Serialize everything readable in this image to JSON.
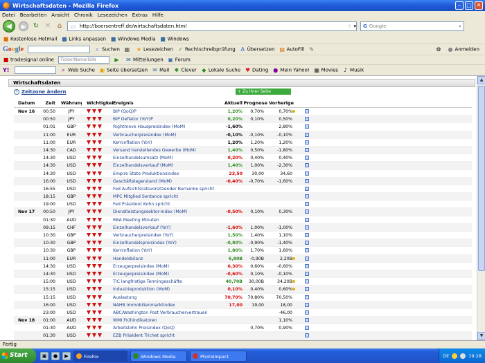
{
  "window": {
    "title": "Wirtschaftsdaten - Mozilla Firefox"
  },
  "menu": [
    "Datei",
    "Bearbeiten",
    "Ansicht",
    "Chronik",
    "Lesezeichen",
    "Extras",
    "Hilfe"
  ],
  "nav": {
    "url": "http://boersentreff.de/wirtschaftsdaten.html",
    "search_placeholder": "Google"
  },
  "bookmarks": [
    "Kostenlose Hotmail",
    "Links anpassen",
    "Windows Media",
    "Windows"
  ],
  "googlebar": {
    "logo": "Google",
    "search": "Suchen",
    "bookmarks_btn": "Lesezeichen",
    "spellcheck": "Rechtschreibprüfung",
    "translate": "Übersetzen",
    "autofill": "AutoFill",
    "signin": "Anmelden"
  },
  "tb3": {
    "tradesignal": "tradesignal online",
    "ticker_placeholder": "Ticker/Name/ISIN",
    "messages": "Mitteilungen",
    "forum": "Forum"
  },
  "tb4": {
    "web_search": "Web Suche",
    "translate": "Seite übersetzen",
    "mail": "Mail",
    "clever": "Clever",
    "local": "Lokale Suche",
    "dating": "Dating",
    "myyahoo": "Mein Yahoo!",
    "movies": "Movies",
    "music": "Musik"
  },
  "page": {
    "heading": "Wirtschaftsdaten",
    "zone_link": "Zeitzone ändern",
    "add_button": "Zu Ihrer Seite hinzufügen"
  },
  "table": {
    "headers": {
      "date": "Datum",
      "time": "Zeit",
      "currency": "Währung",
      "importance": "Wichtigkeit",
      "event": "Ereignis",
      "actual": "Aktuell",
      "forecast": "Prognose",
      "previous": "Vorherige"
    },
    "rows": [
      {
        "date": "Nov 16",
        "time": "00:50",
        "cur": "JPY",
        "imp": 3,
        "event": "BIP (QoQ)P",
        "act": "1,20%",
        "act_color": "green",
        "prog": "0,70%",
        "prev": "0,70%",
        "dot": true
      },
      {
        "date": "",
        "time": "00:50",
        "cur": "JPY",
        "imp": 3,
        "event": "BIP Deflator (YoY)P",
        "act": "0,20%",
        "act_color": "green",
        "prog": "0,10%",
        "prev": "0,50%",
        "dot": false
      },
      {
        "date": "",
        "time": "01:01",
        "cur": "GBP",
        "imp": 3,
        "event": "Rightmove Hauspreisindex (MoM)",
        "act": "-1,60%",
        "act_color": "black",
        "prog": "",
        "prev": "2,80%",
        "dot": false
      },
      {
        "date": "",
        "time": "11:00",
        "cur": "EUR",
        "imp": 3,
        "event": "Verbraucherpreisindex (MoM)",
        "act": "-0,10%",
        "act_color": "black",
        "prog": "-0,10%",
        "prev": "-0,10%",
        "dot": false
      },
      {
        "date": "",
        "time": "11:00",
        "cur": "EUR",
        "imp": 3,
        "event": "Kerninflation (YoY)",
        "act": "1,20%",
        "act_color": "black",
        "prog": "1,20%",
        "prev": "1,20%",
        "dot": false
      },
      {
        "date": "",
        "time": "14:30",
        "cur": "CAD",
        "imp": 3,
        "event": "Versand herstellendes Gewerbe (MoM)",
        "act": "1,40%",
        "act_color": "green",
        "prog": "0,50%",
        "prev": "-1,80%",
        "dot": false
      },
      {
        "date": "",
        "time": "14:30",
        "cur": "USD",
        "imp": 3,
        "event": "Einzelhandelsumsatz (MoM)",
        "act": "0,20%",
        "act_color": "red",
        "prog": "0,40%",
        "prev": "0,40%",
        "dot": false
      },
      {
        "date": "",
        "time": "14:30",
        "cur": "USD",
        "imp": 3,
        "event": "Einzelhandelsverkauf (MoM)",
        "act": "1,40%",
        "act_color": "green",
        "prog": "1,00%",
        "prev": "-2,30%",
        "dot": false
      },
      {
        "date": "",
        "time": "14:30",
        "cur": "USD",
        "imp": 3,
        "event": "Empire State Produktionsindex",
        "act": "23,50",
        "act_color": "red",
        "prog": "30,00",
        "prev": "34,60",
        "dot": false
      },
      {
        "date": "",
        "time": "16:00",
        "cur": "USD",
        "imp": 3,
        "event": "Geschäftslagerstand (MoM)",
        "act": "-0,40%",
        "act_color": "red",
        "prog": "-0,70%",
        "prev": "-1,60%",
        "dot": false
      },
      {
        "date": "",
        "time": "16:55",
        "cur": "USD",
        "imp": 3,
        "event": "Fed Aufsichtsratsvorsitzender Bernanke spricht",
        "act": "",
        "act_color": "black",
        "prog": "",
        "prev": "",
        "dot": false
      },
      {
        "date": "",
        "time": "18:15",
        "cur": "GBP",
        "imp": 3,
        "event": "MPC Mitglied Sentance spricht",
        "act": "",
        "act_color": "black",
        "prog": "",
        "prev": "",
        "dot": false
      },
      {
        "date": "",
        "time": "19:00",
        "cur": "USD",
        "imp": 3,
        "event": "Fed Präsident Kohn spricht",
        "act": "",
        "act_color": "black",
        "prog": "",
        "prev": "",
        "dot": false
      },
      {
        "date": "Nov 17",
        "time": "00:50",
        "cur": "JPY",
        "imp": 3,
        "event": "Dienstleistungssektor-Index (MoM)",
        "act": "-0,50%",
        "act_color": "red",
        "prog": "0,10%",
        "prev": "0,30%",
        "dot": false
      },
      {
        "date": "",
        "time": "01:30",
        "cur": "AUD",
        "imp": 3,
        "event": "RBA Meeting Minuten",
        "act": "",
        "act_color": "black",
        "prog": "",
        "prev": "",
        "dot": false
      },
      {
        "date": "",
        "time": "09:15",
        "cur": "CHF",
        "imp": 3,
        "event": "Einzelhandelsverkauf (YoY)",
        "act": "-1,60%",
        "act_color": "red",
        "prog": "1,00%",
        "prev": "-1,00%",
        "dot": false
      },
      {
        "date": "",
        "time": "10:30",
        "cur": "GBP",
        "imp": 3,
        "event": "Verbraucherpreisindex (YoY)",
        "act": "1,50%",
        "act_color": "green",
        "prog": "1,40%",
        "prev": "1,10%",
        "dot": false
      },
      {
        "date": "",
        "time": "10:30",
        "cur": "GBP",
        "imp": 3,
        "event": "Einzelhandelspreisindex (YoY)",
        "act": "-0,80%",
        "act_color": "green",
        "prog": "-0,90%",
        "prev": "-1,40%",
        "dot": false
      },
      {
        "date": "",
        "time": "10:30",
        "cur": "GBP",
        "imp": 3,
        "event": "Kerninflation (YoY)",
        "act": "1,80%",
        "act_color": "green",
        "prog": "1,70%",
        "prev": "1,60%",
        "dot": false
      },
      {
        "date": "",
        "time": "11:00",
        "cur": "EUR",
        "imp": 3,
        "event": "Handelsbilanz",
        "act": "6,80B",
        "act_color": "green",
        "prog": "-0,90B",
        "prev": "2,20B",
        "dot": true
      },
      {
        "date": "",
        "time": "14:30",
        "cur": "USD",
        "imp": 3,
        "event": "Erzeugerpreisindex (MoM)",
        "act": "0,30%",
        "act_color": "red",
        "prog": "0,60%",
        "prev": "-0,60%",
        "dot": false
      },
      {
        "date": "",
        "time": "14:30",
        "cur": "USD",
        "imp": 3,
        "event": "Erzeugerpreisindex (MoM)",
        "act": "-0,60%",
        "act_color": "red",
        "prog": "0,10%",
        "prev": "-0,10%",
        "dot": false
      },
      {
        "date": "",
        "time": "15:00",
        "cur": "USD",
        "imp": 3,
        "event": "TIC langfristige Termingeschäfte",
        "act": "40,70B",
        "act_color": "green",
        "prog": "30,00B",
        "prev": "34,20B",
        "dot": true
      },
      {
        "date": "",
        "time": "15:15",
        "cur": "USD",
        "imp": 3,
        "event": "Industrieproduktion (MoM)",
        "act": "0,10%",
        "act_color": "red",
        "prog": "0,40%",
        "prev": "0,60%",
        "dot": true
      },
      {
        "date": "",
        "time": "15:15",
        "cur": "USD",
        "imp": 3,
        "event": "Auslastung",
        "act": "70,70%",
        "act_color": "red",
        "prog": "70,80%",
        "prev": "70,50%",
        "dot": false
      },
      {
        "date": "",
        "time": "16:00",
        "cur": "USD",
        "imp": 3,
        "event": "NAHB Immobilienmarktindex",
        "act": "17,00",
        "act_color": "red",
        "prog": "19,00",
        "prev": "18,00",
        "dot": false
      },
      {
        "date": "",
        "time": "23:00",
        "cur": "USD",
        "imp": 3,
        "event": "ABC/Washington Post Verbrauchervertrauen",
        "act": "",
        "act_color": "black",
        "prog": "",
        "prev": "-46,00",
        "dot": false
      },
      {
        "date": "Nov 18",
        "time": "01:00",
        "cur": "AUD",
        "imp": 3,
        "event": "WMI Frühindikatoren",
        "act": "",
        "act_color": "black",
        "prog": "",
        "prev": "1,10%",
        "dot": false
      },
      {
        "date": "",
        "time": "01:30",
        "cur": "AUD",
        "imp": 3,
        "event": "Arbeitslohn Preisindex (QoQ)",
        "act": "",
        "act_color": "black",
        "prog": "0,70%",
        "prev": "0,90%",
        "dot": false
      },
      {
        "date": "",
        "time": "01:30",
        "cur": "USD",
        "imp": 3,
        "event": "EZB Präsident Trichet spricht",
        "act": "",
        "act_color": "black",
        "prog": "",
        "prev": "",
        "dot": false
      }
    ]
  },
  "status": "Fertig",
  "taskbar": {
    "start": "Start",
    "tasks": [
      "Firefox",
      "Windows Media Player",
      "PhotoImpact"
    ],
    "lang": "DE",
    "clock": "19:28"
  }
}
